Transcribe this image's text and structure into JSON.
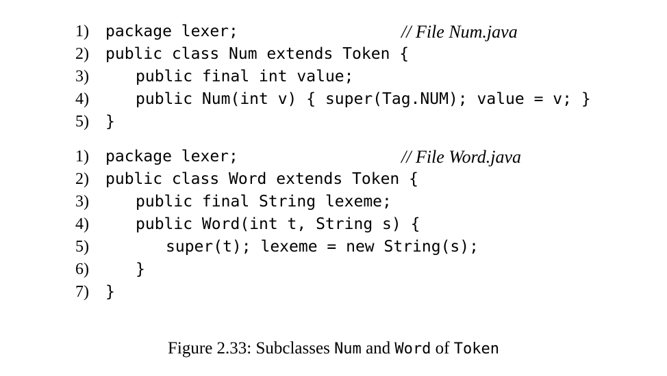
{
  "listings": [
    {
      "comment": "// File Num.java",
      "lines": [
        {
          "num": "1)",
          "indent": 0,
          "code": "package lexer;"
        },
        {
          "num": "2)",
          "indent": 0,
          "code": "public class Num extends Token {"
        },
        {
          "num": "3)",
          "indent": 1,
          "code": "public final int value;"
        },
        {
          "num": "4)",
          "indent": 1,
          "code": "public Num(int v) { super(Tag.NUM); value = v; }"
        },
        {
          "num": "5)",
          "indent": 0,
          "code": "}"
        }
      ]
    },
    {
      "comment": "// File Word.java",
      "lines": [
        {
          "num": "1)",
          "indent": 0,
          "code": "package lexer;"
        },
        {
          "num": "2)",
          "indent": 0,
          "code": "public class Word extends Token {"
        },
        {
          "num": "3)",
          "indent": 1,
          "code": "public final String lexeme;"
        },
        {
          "num": "4)",
          "indent": 1,
          "code": "public Word(int t, String s) {"
        },
        {
          "num": "5)",
          "indent": 2,
          "code": "super(t); lexeme = new String(s);"
        },
        {
          "num": "6)",
          "indent": 1,
          "code": "}"
        },
        {
          "num": "7)",
          "indent": 0,
          "code": "}"
        }
      ]
    }
  ],
  "caption": {
    "label": "Figure 2.33: Subclasses ",
    "class1": "Num",
    "and": " and ",
    "class2": "Word",
    "of": " of ",
    "class3": "Token"
  }
}
